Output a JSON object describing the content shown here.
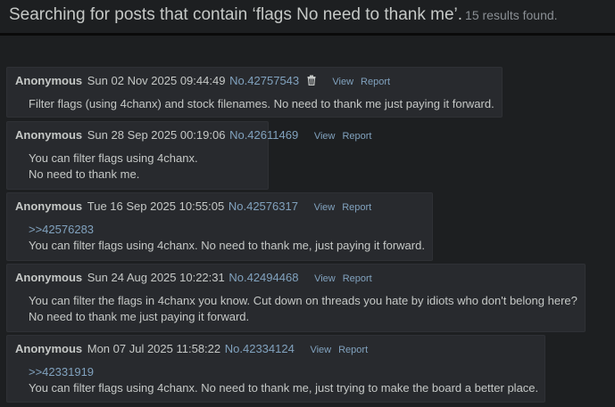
{
  "header": {
    "query_text": "Searching for posts that contain ‘flags No need to thank me’.",
    "result_count": "15 results found."
  },
  "posts": [
    {
      "name": "Anonymous",
      "date": "Sun 02 Nov 2025 09:44:49",
      "number": "No.42757543",
      "view_label": "View",
      "report_label": "Report",
      "has_delete_icon": true,
      "lines": [
        "Filter flags (using 4chanx) and stock filenames. No need to thank me just paying it forward."
      ]
    },
    {
      "name": "Anonymous",
      "date": "Sun 28 Sep 2025 00:19:06",
      "number": "No.42611469",
      "view_label": "View",
      "report_label": "Report",
      "lines": [
        "You can filter flags using 4chanx.",
        "No need to thank me."
      ]
    },
    {
      "name": "Anonymous",
      "date": "Tue 16 Sep 2025 10:55:05",
      "number": "No.42576317",
      "view_label": "View",
      "report_label": "Report",
      "quote": ">>42576283",
      "lines": [
        "You can filter flags using 4chanx. No need to thank me, just paying it forward."
      ]
    },
    {
      "name": "Anonymous",
      "date": "Sun 24 Aug 2025 10:22:31",
      "number": "No.42494468",
      "view_label": "View",
      "report_label": "Report",
      "lines": [
        "You can filter the flags in 4chanx you know. Cut down on threads you hate by idiots who don't belong here?",
        "No need to thank me just paying it forward."
      ]
    },
    {
      "name": "Anonymous",
      "date": "Mon 07 Jul 2025 11:58:22",
      "number": "No.42334124",
      "view_label": "View",
      "report_label": "Report",
      "quote": ">>42331919",
      "lines": [
        "You can filter flags using 4chanx. No need to thank me, just trying to make the board a better place."
      ]
    }
  ],
  "colors": {
    "background": "#1d1f21",
    "post_background": "#282a2e",
    "text": "#c5c8c6",
    "link": "#81a2be"
  },
  "icons": {
    "delete": "trash-icon"
  }
}
